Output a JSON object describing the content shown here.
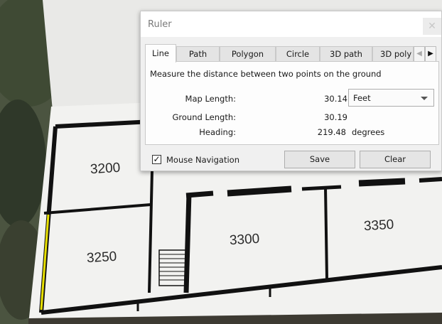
{
  "map": {
    "rooms": [
      "3200",
      "3250",
      "3300",
      "3350"
    ]
  },
  "dialog": {
    "title": "Ruler",
    "close_icon": "close-icon",
    "tabs": [
      "Line",
      "Path",
      "Polygon",
      "Circle",
      "3D path",
      "3D poly"
    ],
    "active_tab": "Line",
    "instruction": "Measure the distance between two points on the ground",
    "map_length": {
      "label": "Map Length:",
      "value": "30.14"
    },
    "unit_select": {
      "value": "Feet"
    },
    "ground_length": {
      "label": "Ground Length:",
      "value": "30.19"
    },
    "heading": {
      "label": "Heading:",
      "value": "219.48",
      "units": "degrees"
    },
    "mouse_navigation": {
      "label": "Mouse Navigation",
      "checked": true
    },
    "save_label": "Save",
    "clear_label": "Clear",
    "accent_measure_line": "#e8e000"
  }
}
